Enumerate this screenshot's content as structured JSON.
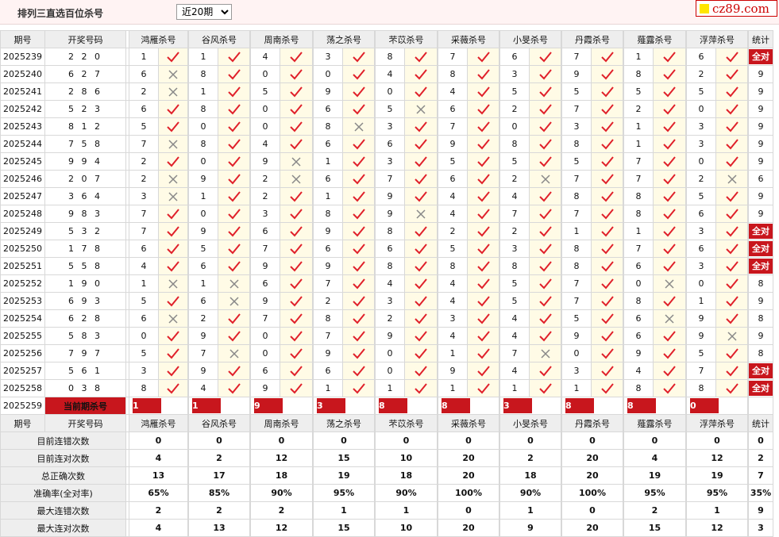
{
  "header": {
    "title": "排列三直选百位杀号",
    "select_value": "近20期",
    "logo_text": "cz89.com"
  },
  "columns": {
    "issue": "期号",
    "draw": "开奖号码",
    "stat": "统计",
    "experts": [
      "鸿雁杀号",
      "谷风杀号",
      "周南杀号",
      "荡之杀号",
      "芣苡杀号",
      "采薇杀号",
      "小旻杀号",
      "丹霞杀号",
      "薤露杀号",
      "浮萍杀号"
    ]
  },
  "rows": [
    {
      "issue": "2025239",
      "draw": "2 2 0",
      "k": [
        1,
        1,
        4,
        3,
        8,
        7,
        6,
        7,
        1,
        6
      ],
      "r": [
        1,
        1,
        1,
        1,
        1,
        1,
        1,
        1,
        1,
        1
      ],
      "stat": "全对"
    },
    {
      "issue": "2025240",
      "draw": "6 2 7",
      "k": [
        6,
        8,
        0,
        0,
        4,
        8,
        3,
        9,
        8,
        2
      ],
      "r": [
        0,
        1,
        1,
        1,
        1,
        1,
        1,
        1,
        1,
        1
      ],
      "stat": "9"
    },
    {
      "issue": "2025241",
      "draw": "2 8 6",
      "k": [
        2,
        1,
        5,
        9,
        0,
        4,
        5,
        5,
        5,
        5
      ],
      "r": [
        0,
        1,
        1,
        1,
        1,
        1,
        1,
        1,
        1,
        1
      ],
      "stat": "9"
    },
    {
      "issue": "2025242",
      "draw": "5 2 3",
      "k": [
        6,
        8,
        0,
        6,
        5,
        6,
        2,
        7,
        2,
        0
      ],
      "r": [
        1,
        1,
        1,
        1,
        0,
        1,
        1,
        1,
        1,
        1
      ],
      "stat": "9"
    },
    {
      "issue": "2025243",
      "draw": "8 1 2",
      "k": [
        5,
        0,
        0,
        8,
        3,
        7,
        0,
        3,
        1,
        3
      ],
      "r": [
        1,
        1,
        1,
        0,
        1,
        1,
        1,
        1,
        1,
        1
      ],
      "stat": "9"
    },
    {
      "issue": "2025244",
      "draw": "7 5 8",
      "k": [
        7,
        8,
        4,
        6,
        6,
        9,
        8,
        8,
        1,
        3
      ],
      "r": [
        0,
        1,
        1,
        1,
        1,
        1,
        1,
        1,
        1,
        1
      ],
      "stat": "9"
    },
    {
      "issue": "2025245",
      "draw": "9 9 4",
      "k": [
        2,
        0,
        9,
        1,
        3,
        5,
        5,
        5,
        7,
        0
      ],
      "r": [
        1,
        1,
        0,
        1,
        1,
        1,
        1,
        1,
        1,
        1
      ],
      "stat": "9"
    },
    {
      "issue": "2025246",
      "draw": "2 0 7",
      "k": [
        2,
        9,
        2,
        6,
        7,
        6,
        2,
        7,
        7,
        2
      ],
      "r": [
        0,
        1,
        0,
        1,
        1,
        1,
        0,
        1,
        1,
        0
      ],
      "stat": "6"
    },
    {
      "issue": "2025247",
      "draw": "3 6 4",
      "k": [
        3,
        1,
        2,
        1,
        9,
        4,
        4,
        8,
        8,
        5
      ],
      "r": [
        0,
        1,
        1,
        1,
        1,
        1,
        1,
        1,
        1,
        1
      ],
      "stat": "9"
    },
    {
      "issue": "2025248",
      "draw": "9 8 3",
      "k": [
        7,
        0,
        3,
        8,
        9,
        4,
        7,
        7,
        8,
        6
      ],
      "r": [
        1,
        1,
        1,
        1,
        0,
        1,
        1,
        1,
        1,
        1
      ],
      "stat": "9"
    },
    {
      "issue": "2025249",
      "draw": "5 3 2",
      "k": [
        7,
        9,
        6,
        9,
        8,
        2,
        2,
        1,
        1,
        3
      ],
      "r": [
        1,
        1,
        1,
        1,
        1,
        1,
        1,
        1,
        1,
        1
      ],
      "stat": "全对"
    },
    {
      "issue": "2025250",
      "draw": "1 7 8",
      "k": [
        6,
        5,
        7,
        6,
        6,
        5,
        3,
        8,
        7,
        6
      ],
      "r": [
        1,
        1,
        1,
        1,
        1,
        1,
        1,
        1,
        1,
        1
      ],
      "stat": "全对"
    },
    {
      "issue": "2025251",
      "draw": "5 5 8",
      "k": [
        4,
        6,
        9,
        9,
        8,
        8,
        8,
        8,
        6,
        3
      ],
      "r": [
        1,
        1,
        1,
        1,
        1,
        1,
        1,
        1,
        1,
        1
      ],
      "stat": "全对"
    },
    {
      "issue": "2025252",
      "draw": "1 9 0",
      "k": [
        1,
        1,
        6,
        7,
        4,
        4,
        5,
        7,
        0,
        0
      ],
      "r": [
        0,
        0,
        1,
        1,
        1,
        1,
        1,
        1,
        0,
        1
      ],
      "stat": "8"
    },
    {
      "issue": "2025253",
      "draw": "6 9 3",
      "k": [
        5,
        6,
        9,
        2,
        3,
        4,
        5,
        7,
        8,
        1
      ],
      "r": [
        1,
        0,
        1,
        1,
        1,
        1,
        1,
        1,
        1,
        1
      ],
      "stat": "9"
    },
    {
      "issue": "2025254",
      "draw": "6 2 8",
      "k": [
        6,
        2,
        7,
        8,
        2,
        3,
        4,
        5,
        6,
        9
      ],
      "r": [
        0,
        1,
        1,
        1,
        1,
        1,
        1,
        1,
        0,
        1
      ],
      "stat": "8"
    },
    {
      "issue": "2025255",
      "draw": "5 8 3",
      "k": [
        0,
        9,
        0,
        7,
        9,
        4,
        4,
        9,
        6,
        9
      ],
      "r": [
        1,
        1,
        1,
        1,
        1,
        1,
        1,
        1,
        1,
        0
      ],
      "stat": "9"
    },
    {
      "issue": "2025256",
      "draw": "7 9 7",
      "k": [
        5,
        7,
        0,
        9,
        0,
        1,
        7,
        0,
        9,
        5
      ],
      "r": [
        1,
        0,
        1,
        1,
        1,
        1,
        0,
        1,
        1,
        1
      ],
      "stat": "8"
    },
    {
      "issue": "2025257",
      "draw": "5 6 1",
      "k": [
        3,
        9,
        6,
        6,
        0,
        9,
        4,
        3,
        4,
        7
      ],
      "r": [
        1,
        1,
        1,
        1,
        1,
        1,
        1,
        1,
        1,
        1
      ],
      "stat": "全对"
    },
    {
      "issue": "2025258",
      "draw": "0 3 8",
      "k": [
        8,
        4,
        9,
        1,
        1,
        1,
        1,
        1,
        8,
        8
      ],
      "r": [
        1,
        1,
        1,
        1,
        1,
        1,
        1,
        1,
        1,
        1
      ],
      "stat": "全对"
    }
  ],
  "current": {
    "issue": "2025259",
    "label": "当前期杀号",
    "kills": [
      "1",
      "1",
      "9",
      "3",
      "8",
      "8",
      "3",
      "8",
      "8",
      "0"
    ]
  },
  "stats": [
    {
      "label": "目前连错次数",
      "vals": [
        "0",
        "0",
        "0",
        "0",
        "0",
        "0",
        "0",
        "0",
        "0",
        "0"
      ],
      "stat": "0",
      "red": false
    },
    {
      "label": "目前连对次数",
      "vals": [
        "4",
        "2",
        "12",
        "15",
        "10",
        "20",
        "2",
        "20",
        "4",
        "12"
      ],
      "stat": "2",
      "red": false
    },
    {
      "label": "总正确次数",
      "vals": [
        "13",
        "17",
        "18",
        "19",
        "18",
        "20",
        "18",
        "20",
        "19",
        "19"
      ],
      "stat": "7",
      "red": false
    },
    {
      "label": "准确率(全对率)",
      "vals": [
        "65%",
        "85%",
        "90%",
        "95%",
        "90%",
        "100%",
        "90%",
        "100%",
        "95%",
        "95%"
      ],
      "stat": "35%",
      "red": true
    },
    {
      "label": "最大连错次数",
      "vals": [
        "2",
        "2",
        "2",
        "1",
        "1",
        "0",
        "1",
        "0",
        "2",
        "1"
      ],
      "stat": "9",
      "red": false
    },
    {
      "label": "最大连对次数",
      "vals": [
        "4",
        "13",
        "12",
        "15",
        "10",
        "20",
        "9",
        "20",
        "15",
        "12"
      ],
      "stat": "3",
      "red": false
    }
  ],
  "colors": {
    "accent": "#c8161d",
    "check": "#e0202a",
    "cross": "#888888",
    "stat_blue": "#0000cc"
  }
}
